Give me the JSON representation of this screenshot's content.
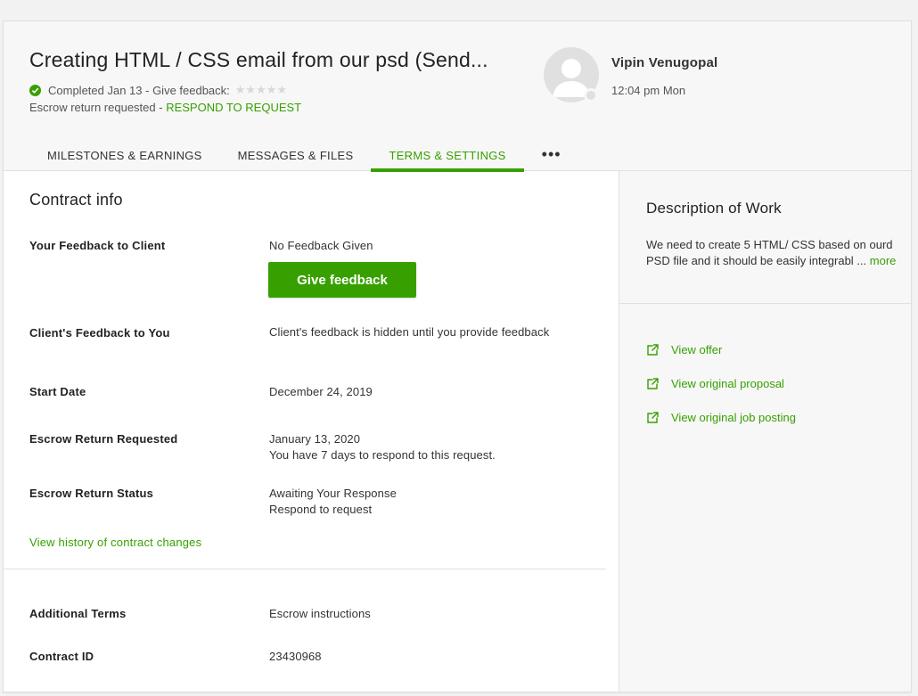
{
  "header": {
    "title": "Creating HTML / CSS email from our psd (Send...",
    "status": "Completed Jan 13 - Give feedback:",
    "stars": "★★★★★",
    "escrow_prefix": "Escrow return requested - ",
    "escrow_link": "RESPOND TO REQUEST",
    "person_name": "Vipin Venugopal",
    "person_time": "12:04 pm Mon"
  },
  "tabs": [
    {
      "label": "MILESTONES & EARNINGS"
    },
    {
      "label": "MESSAGES & FILES"
    },
    {
      "label": "TERMS & SETTINGS"
    }
  ],
  "tab_more": "•••",
  "contract": {
    "title": "Contract info",
    "feedback_to_client_label": "Your Feedback to Client",
    "feedback_to_client_value": "No Feedback Given",
    "give_feedback_button": "Give feedback",
    "client_feedback_label": "Client's Feedback to You",
    "client_feedback_value": "Client's feedback is hidden until you provide feedback",
    "start_date_label": "Start Date",
    "start_date_value": "December 24, 2019",
    "escrow_requested_label": "Escrow Return Requested",
    "escrow_requested_date": "January 13, 2020",
    "escrow_requested_note": "You have 7 days to respond to this request.",
    "escrow_status_label": "Escrow Return Status",
    "escrow_status_value": "Awaiting Your Response",
    "escrow_status_link": "Respond to request",
    "history_link": "View history of contract changes",
    "additional_terms_label": "Additional Terms",
    "additional_terms_link": "Escrow instructions",
    "contract_id_label": "Contract ID",
    "contract_id_value": "23430968"
  },
  "description": {
    "title": "Description of Work",
    "text": "We need to create 5 HTML/ CSS based on ourd PSD file and it should be easily integrabl ...",
    "more": "more",
    "links": [
      "View offer",
      "View original proposal",
      "View original job posting"
    ]
  },
  "colors": {
    "accent": "#37a000"
  }
}
